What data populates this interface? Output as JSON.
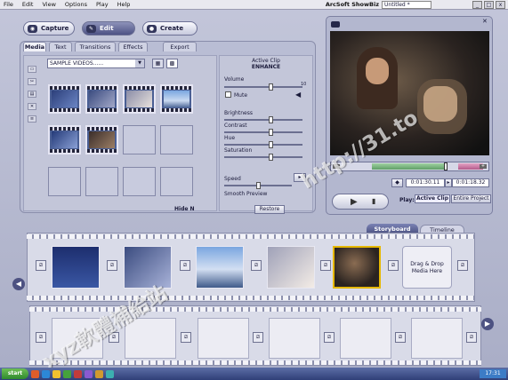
{
  "menubar": {
    "items": [
      "File",
      "Edit",
      "View",
      "Options",
      "Play",
      "Help"
    ],
    "app_title": "ArcSoft ShowBiz",
    "doc_title": "Untitled *",
    "window_buttons": [
      "_",
      "□",
      "x"
    ]
  },
  "modes": {
    "capture": "Capture",
    "edit": "Edit",
    "create": "Create"
  },
  "tabs": {
    "media": "Media",
    "text": "Text",
    "transitions": "Transitions",
    "effects": "Effects",
    "export": "Export"
  },
  "media": {
    "dropdown_value": "SAMPLE VIDEOS......",
    "hide_label": "Hide N"
  },
  "active_clip": {
    "header": "Active Clip",
    "enhance": "ENHANCE",
    "volume": "Volume",
    "volume_value": "10",
    "mute": "Mute",
    "brightness": "Brightness",
    "contrast": "Contrast",
    "hue": "Hue",
    "saturation": "Saturation",
    "speed": "Speed",
    "smooth_preview": "Smooth Preview",
    "restore": "Restore"
  },
  "player": {
    "time_start": "0:01:30.11",
    "time_end": "0:01:18.32",
    "play_label": "Play:",
    "active_clip_btn": "Active Clip",
    "entire_project_btn": "Entire Project"
  },
  "view_tabs": {
    "storyboard": "Storyboard",
    "timeline": "Timeline"
  },
  "storyboard": {
    "drop_text": "Drag & Drop Media Here"
  },
  "watermark": {
    "line1": "xyz軟體補給站",
    "line2": "http://31.to"
  },
  "taskbar": {
    "start": "start",
    "clock": "17:31"
  },
  "colors": {
    "accent": "#4e5385",
    "background": "#b4b8cf",
    "video_bg": "#2a2320"
  }
}
